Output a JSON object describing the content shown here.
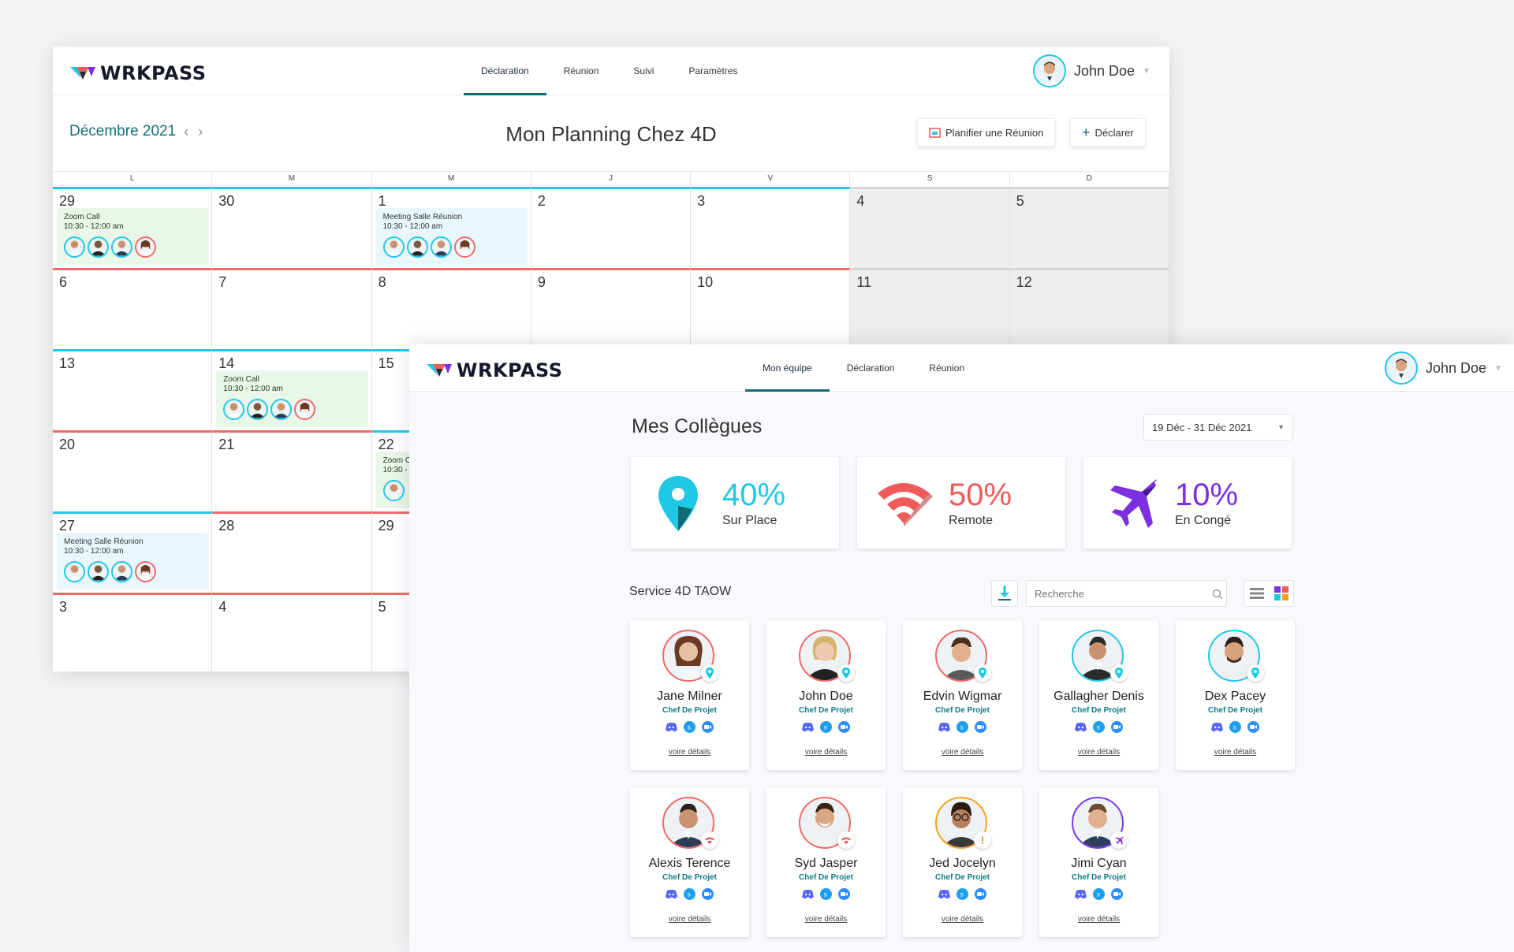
{
  "brand": "WRKPASS",
  "colors": {
    "teal": "#0f6b76",
    "cyan": "#25c7e5",
    "red": "#ef6a6a",
    "purple": "#7c3aed"
  },
  "calendar_window": {
    "nav": [
      "Déclaration",
      "Réunion",
      "Suivi",
      "Paramètres"
    ],
    "active_nav": "Déclaration",
    "user": "John Doe",
    "month": "Décembre 2021",
    "title": "Mon Planning Chez 4D",
    "buttons": {
      "plan": "Planifier une Réunion",
      "declare": "Déclarer"
    },
    "days_of_week": [
      "L",
      "M",
      "M",
      "J",
      "V",
      "S",
      "D"
    ],
    "weeks": [
      [
        "29",
        "30",
        "1",
        "2",
        "3",
        "4",
        "5"
      ],
      [
        "6",
        "7",
        "8",
        "9",
        "10",
        "11",
        "12"
      ],
      [
        "13",
        "14",
        "15",
        "",
        "",
        "",
        ""
      ],
      [
        "20",
        "21",
        "22",
        "",
        "",
        "",
        ""
      ],
      [
        "27",
        "28",
        "29",
        "",
        "",
        "",
        ""
      ],
      [
        "3",
        "4",
        "5",
        "",
        "",
        "",
        ""
      ]
    ],
    "events": [
      {
        "title": "Zoom Call",
        "time": "10:30 - 12:00 am"
      },
      {
        "title": "Meeting Salle Réunion",
        "time": "10:30 - 12:00 am"
      },
      {
        "title": "Zoom Call",
        "time": "10:30 - 12:00 am"
      },
      {
        "title": "Zoom C",
        "time": "10:30 -"
      },
      {
        "title": "Meeting Salle Réunion",
        "time": "10:30 - 12:00 am"
      }
    ]
  },
  "team_window": {
    "nav": [
      "Mon équipe",
      "Déclaration",
      "Réunion"
    ],
    "active_nav": "Mon équipe",
    "user": "John Doe",
    "title": "Mes Collègues",
    "date_range": "19 Déc - 31 Déc 2021",
    "stats": [
      {
        "percent": "40%",
        "label": "Sur Place",
        "color": "#1fc8e3",
        "icon": "location-pin-icon"
      },
      {
        "percent": "50%",
        "label": "Remote",
        "color": "#ee5a5a",
        "icon": "wifi-icon"
      },
      {
        "percent": "10%",
        "label": "En Congé",
        "color": "#7c2fe0",
        "icon": "airplane-icon"
      }
    ],
    "service": "Service 4D TAOW",
    "search_placeholder": "Recherche",
    "details_label": "voire détails",
    "colleagues": [
      {
        "name": "Jane Milner",
        "role": "Chef De Projet",
        "status": "location"
      },
      {
        "name": "John Doe",
        "role": "Chef De Projet",
        "status": "location"
      },
      {
        "name": "Edvin Wigmar",
        "role": "Chef De Projet",
        "status": "location"
      },
      {
        "name": "Gallagher Denis",
        "role": "Chef De Projet",
        "status": "location"
      },
      {
        "name": "Dex Pacey",
        "role": "Chef De Projet",
        "status": "location"
      },
      {
        "name": "Alexis Terence",
        "role": "Chef De Projet",
        "status": "remote"
      },
      {
        "name": "Syd Jasper",
        "role": "Chef De Projet",
        "status": "remote"
      },
      {
        "name": "Jed Jocelyn",
        "role": "Chef De Projet",
        "status": "warning"
      },
      {
        "name": "Jimi Cyan",
        "role": "Chef De Projet",
        "status": "leave"
      }
    ]
  }
}
